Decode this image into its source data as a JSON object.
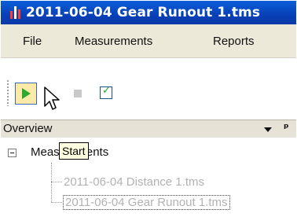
{
  "window": {
    "title": "2011-06-04 Gear Runout 1.tms",
    "app_icon": "app-logo-icon"
  },
  "menu": {
    "items": [
      "File",
      "Measurements",
      "Reports"
    ]
  },
  "toolbar": {
    "start_icon": "play-icon",
    "stop_icon": "stop-icon",
    "check_icon": "checkbox-icon",
    "tooltip": "Start"
  },
  "overview": {
    "title": "Overview",
    "dropdown_icon": "dropdown-arrow-icon",
    "pin_icon": "pin-icon",
    "tree": {
      "root_label": "Measurements",
      "expanded": true,
      "items": [
        "2011-06-04 Distance 1.tms",
        "2011-06-04 Gear Runout 1.tms"
      ]
    }
  },
  "colors": {
    "titlebar": "#0a4bd0",
    "start_button_highlight": "#fde9a8",
    "play_green": "#2fa82f",
    "tooltip_bg": "#ffffe1",
    "disabled_text": "#b2b2b2"
  }
}
